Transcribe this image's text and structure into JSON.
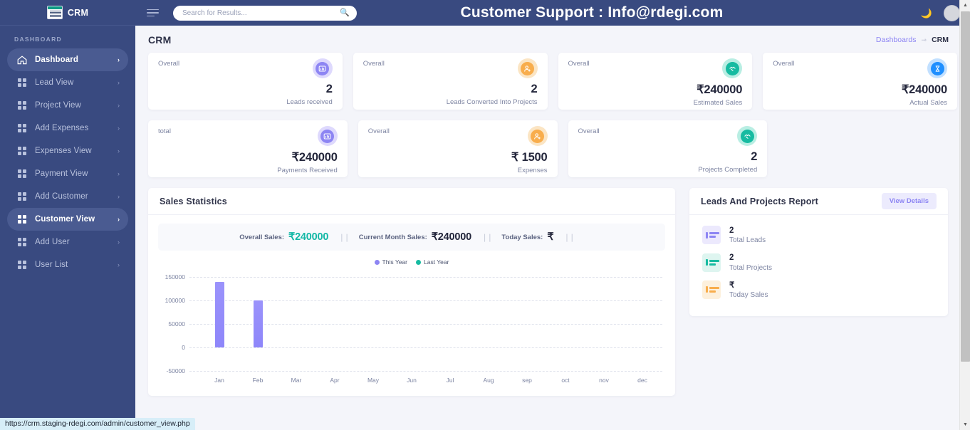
{
  "brand": {
    "name": "CRM",
    "logo_icon": "logo-image"
  },
  "sidebar": {
    "section_title": "DASHBOARD",
    "items": [
      {
        "label": "Dashboard",
        "icon": "home-icon",
        "arrow": "›",
        "active": true
      },
      {
        "label": "Lead View",
        "icon": "grid-icon",
        "arrow": "›",
        "active": false
      },
      {
        "label": "Project View",
        "icon": "grid-icon",
        "arrow": "›",
        "active": false
      },
      {
        "label": "Add Expenses",
        "icon": "grid-icon",
        "arrow": "›",
        "active": false
      },
      {
        "label": "Expenses View",
        "icon": "grid-icon",
        "arrow": "›",
        "active": false
      },
      {
        "label": "Payment View",
        "icon": "grid-icon",
        "arrow": "›",
        "active": false
      },
      {
        "label": "Add Customer",
        "icon": "grid-icon",
        "arrow": "›",
        "active": false
      },
      {
        "label": "Customer View",
        "icon": "grid-icon",
        "arrow": "›",
        "active": true
      },
      {
        "label": "Add User",
        "icon": "grid-icon",
        "arrow": "›",
        "active": false
      },
      {
        "label": "User List",
        "icon": "grid-icon",
        "arrow": "›",
        "active": false
      }
    ]
  },
  "topbar": {
    "menu_icon": "hamburger-icon",
    "search": {
      "placeholder": "Search for Results...",
      "value": "",
      "icon": "search-icon"
    },
    "support_title": "Customer Support : Info@rdegi.com",
    "theme_toggle_icon": "🌙",
    "avatar_icon": "avatar"
  },
  "page": {
    "title": "CRM",
    "breadcrumb": {
      "parent": "Dashboards",
      "separator": "⇾",
      "current": "CRM"
    }
  },
  "stats": [
    {
      "kicker": "Overall",
      "value": "2",
      "label": "Leads received",
      "icon": "chart-box-icon",
      "color": "#8d85f3",
      "bg": "#ded9fd"
    },
    {
      "kicker": "Overall",
      "value": "2",
      "label": "Leads Converted Into Projects",
      "icon": "user-plus-icon",
      "color": "#f8ad4c",
      "bg": "#fbe5c4"
    },
    {
      "kicker": "Overall",
      "value": "₹240000",
      "label": "Estimated Sales",
      "icon": "handshake-icon",
      "color": "#16bba1",
      "bg": "#b9eee3"
    },
    {
      "kicker": "Overall",
      "value": "₹240000",
      "label": "Actual Sales",
      "icon": "hourglass-icon",
      "color": "#1f8fff",
      "bg": "#c2e0ff"
    },
    {
      "kicker": "total",
      "value": "₹240000",
      "label": "Payments Received",
      "icon": "chart-box-icon",
      "color": "#8d85f3",
      "bg": "#ded9fd"
    },
    {
      "kicker": "Overall",
      "value": "₹ 1500",
      "label": "Expenses",
      "icon": "user-plus-icon",
      "color": "#f8ad4c",
      "bg": "#fbe5c4"
    },
    {
      "kicker": "Overall",
      "value": "2",
      "label": "Projects Completed",
      "icon": "handshake-icon",
      "color": "#16bba1",
      "bg": "#b9eee3"
    }
  ],
  "sales_panel": {
    "title": "Sales Statistics",
    "summary": [
      {
        "key": "Overall Sales:",
        "value": "₹240000",
        "tone": "green"
      },
      {
        "key": "Current Month Sales:",
        "value": "₹240000",
        "tone": "dark"
      },
      {
        "key": "Today Sales:",
        "value": "₹",
        "tone": "dark"
      }
    ],
    "divider": "❘❘"
  },
  "report_panel": {
    "title": "Leads And Projects Report",
    "button": "View Details",
    "rows": [
      {
        "value": "2",
        "name": "Total Leads",
        "icon": "bars-icon",
        "bg": "#ece9fd",
        "color": "#8d85f3"
      },
      {
        "value": "2",
        "name": "Total Projects",
        "icon": "bars-icon",
        "bg": "#def5f0",
        "color": "#16bba1"
      },
      {
        "value": "₹",
        "name": "Today Sales",
        "icon": "bars-icon",
        "bg": "#fdf0dc",
        "color": "#f8ad4c"
      }
    ]
  },
  "chart_data": {
    "type": "bar",
    "title": "Sales Statistics",
    "categories": [
      "Jan",
      "Feb",
      "Mar",
      "Apr",
      "May",
      "Jun",
      "Jul",
      "Aug",
      "sep",
      "oct",
      "nov",
      "dec"
    ],
    "series": [
      {
        "name": "This Year",
        "color": "#8d85f3",
        "values": [
          140000,
          100000,
          0,
          0,
          0,
          0,
          0,
          0,
          0,
          0,
          0,
          0
        ]
      },
      {
        "name": "Last Year",
        "color": "#16bba1",
        "values": [
          0,
          0,
          0,
          0,
          0,
          0,
          0,
          0,
          0,
          0,
          0,
          0
        ]
      }
    ],
    "legend": [
      {
        "label": "This Year",
        "color": "#8d85f3"
      },
      {
        "label": "Last Year",
        "color": "#16bba1"
      }
    ],
    "yticks": [
      150000,
      100000,
      50000,
      0,
      -50000
    ],
    "ytick_labels": [
      "150000",
      "100000",
      "50000",
      "0",
      "-50000"
    ],
    "ylim": [
      -50000,
      150000
    ],
    "xlabel": "",
    "ylabel": "",
    "grid": true,
    "legend_position": "top-center"
  },
  "status_bar": {
    "url": "https://crm.staging-rdegi.com/admin/customer_view.php"
  }
}
